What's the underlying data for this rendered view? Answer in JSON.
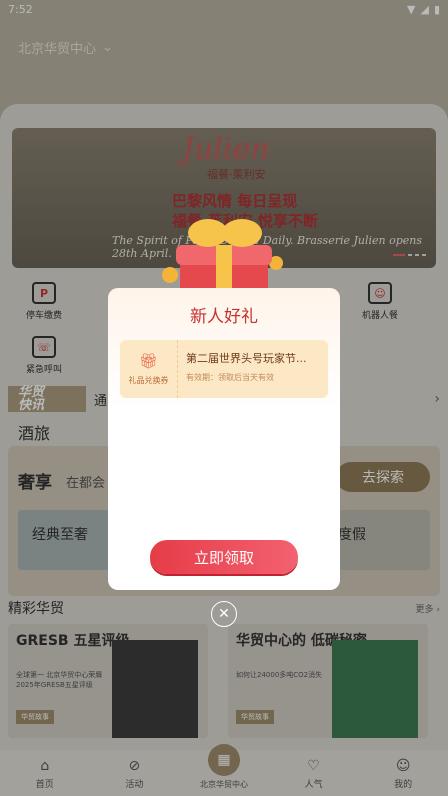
{
  "status_bar": {
    "time": "7:52"
  },
  "header": {
    "city": "北京华贸中心"
  },
  "banner": {
    "brand": "Julien",
    "sub": "福餐·茱利安",
    "line1": "巴黎风情 每日呈现",
    "line2": "福餐·茱利安 悦享不断",
    "line3": "The Spirit of Paris, Served Daily. Brasserie Julien opens 28th April."
  },
  "shortcuts": [
    {
      "label": "停车缴费"
    },
    {
      "label": "机器人餐"
    },
    {
      "label": "紧急呼叫"
    }
  ],
  "ticker": {
    "logo_line1": "华贸",
    "logo_line2": "快讯",
    "message": "通"
  },
  "section_hotel": {
    "title": "酒旅"
  },
  "lux": {
    "title": "奢享",
    "subtitle": "在都会",
    "explore_button": "去探索",
    "card1": "经典至奢",
    "card2": "度假"
  },
  "wonderful": {
    "title": "精彩华贸",
    "more": "更多 ›"
  },
  "stories": [
    {
      "title": "GRESB 五星评级",
      "desc": "全球第一 北京华贸中心荣膺2025年GRESB五星评级",
      "tag": "华贸故事"
    },
    {
      "title": "华贸中心的 低碳秘密",
      "desc": "如何让24000多吨CO2消失",
      "tag": "华贸故事"
    }
  ],
  "tabbar": [
    {
      "label": "首页",
      "icon": "home-icon"
    },
    {
      "label": "活动",
      "icon": "compass-icon"
    },
    {
      "label": "北京华贸中心",
      "icon": "grid-icon"
    },
    {
      "label": "人气",
      "icon": "thumb-icon"
    },
    {
      "label": "我的",
      "icon": "user-icon"
    }
  ],
  "modal": {
    "title": "新人好礼",
    "coupon_type": "礼品兑换券",
    "coupon_name": "第二届世界头号玩家节...",
    "coupon_valid": "有效期：领取后当天有效",
    "claim_button": "立即领取"
  },
  "colors": {
    "accent": "#c8312e",
    "button": "#e63c48",
    "brand": "#9e8d6b"
  }
}
